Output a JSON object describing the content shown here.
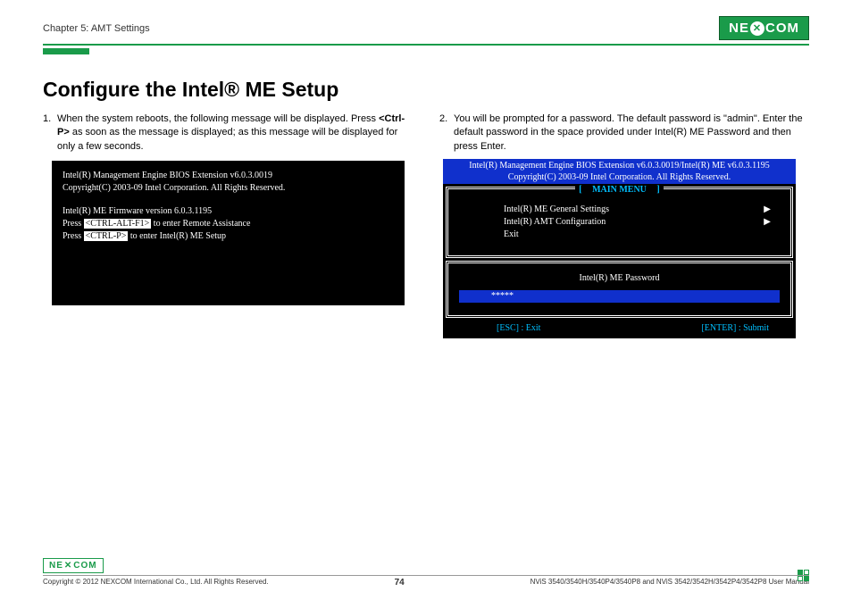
{
  "header": {
    "chapter": "Chapter 5: AMT Settings",
    "logo": {
      "pre": "NE",
      "x": "✕",
      "post": "COM"
    }
  },
  "title": "Configure the Intel® ME Setup",
  "left": {
    "num": "1.",
    "text_a": "When the system reboots, the following message will be displayed. Press ",
    "text_b": "<Ctrl-P>",
    "text_c": " as soon as the message is displayed; as this message will be displayed for only a few seconds.",
    "bios": {
      "l1": "Intel(R) Management Engine BIOS Extension v6.0.3.0019",
      "l2": "Copyright(C) 2003-09 Intel Corporation. All Rights Reserved.",
      "l3": "Intel(R) ME Firmware version 6.0.3.1195",
      "l4a": "Press ",
      "l4b": "<CTRL-ALT-F1>",
      "l4c": " to enter Remote Assistance",
      "l5a": "Press ",
      "l5b": "<CTRL-P>",
      "l5c": " to enter Intel(R) ME Setup"
    }
  },
  "right": {
    "num": "2.",
    "text": "You will be prompted for a password. The default password is \"admin\". Enter the default password in the space provided under Intel(R) ME Password and then press Enter.",
    "menu": {
      "h1": "Intel(R) Management Engine BIOS Extension v6.0.3.0019/Intel(R) ME v6.0.3.1195",
      "h2": "Copyright(C) 2003-09 Intel Corporation. All Rights Reserved.",
      "title": "MAIN MENU",
      "item1": "Intel(R) ME General Settings",
      "item2": "Intel(R) AMT Configuration",
      "item3": "Exit",
      "pw_label": "Intel(R) ME Password",
      "pw_value": "*****",
      "esc": "[ESC] : Exit",
      "enter": "[ENTER] : Submit"
    }
  },
  "footer": {
    "copyright": "Copyright © 2012 NEXCOM International Co., Ltd. All Rights Reserved.",
    "page": "74",
    "manual": "NViS 3540/3540H/3540P4/3540P8 and NViS 3542/3542H/3542P4/3542P8 User Manual"
  }
}
